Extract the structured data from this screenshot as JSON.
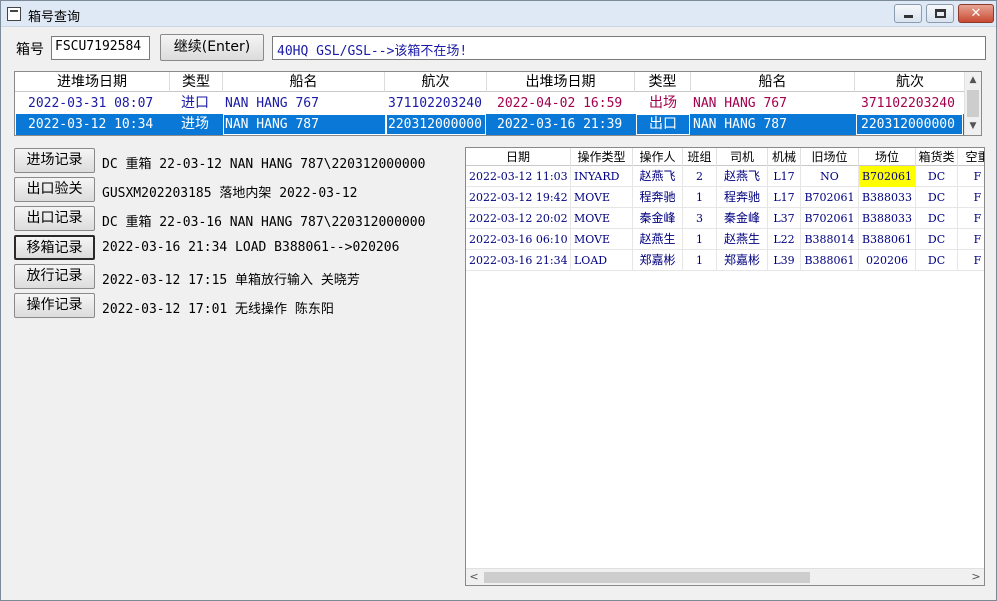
{
  "window": {
    "title": "箱号查询",
    "controls": {
      "minimize": "minimize-icon",
      "maximize": "maximize-icon",
      "close": "close-icon",
      "close_glyph": "✕"
    }
  },
  "search": {
    "label": "箱号",
    "value": "FSCU7192584",
    "continue_label": "继续(Enter)",
    "message": "40HQ GSL/GSL-->该箱不在场!"
  },
  "top_list": {
    "columns": [
      "进堆场日期",
      "类型",
      "船名",
      "航次",
      "出堆场日期",
      "类型",
      "船名",
      "航次"
    ],
    "rows": [
      {
        "in_date": "2022-03-31 08:07",
        "in_type": "进口",
        "in_vessel": "NAN HANG 767",
        "in_voyage": "371102203240",
        "out_date": "2022-04-02 16:59",
        "out_type": "出场",
        "out_vessel": "NAN HANG 767",
        "out_voyage": "371102203240"
      },
      {
        "in_date": "2022-03-12 10:34",
        "in_type": "进场",
        "in_vessel": "NAN HANG 787",
        "in_voyage": "220312000000",
        "out_date": "2022-03-16 21:39",
        "out_type": "出口",
        "out_vessel": "NAN HANG 787",
        "out_voyage": "220312000000"
      }
    ],
    "scroll_up": "▲",
    "scroll_down": "▼"
  },
  "records": [
    {
      "button": "进场记录",
      "text": "DC 重箱 22-03-12 NAN HANG 787\\220312000000"
    },
    {
      "button": "出口验关",
      "text": "GUSXM202203185 落地内架 2022-03-12"
    },
    {
      "button": "出口记录",
      "text": "DC 重箱 22-03-16 NAN HANG 787\\220312000000"
    },
    {
      "button": "移箱记录",
      "text": "2022-03-16 21:34 LOAD B388061-->020206"
    },
    {
      "button": "放行记录",
      "text": "2022-03-12 17:15 单箱放行输入 关晓芳"
    },
    {
      "button": "操作记录",
      "text": "2022-03-12 17:01 无线操作 陈东阳"
    }
  ],
  "grid": {
    "columns": [
      "日期",
      "操作类型",
      "操作人",
      "班组",
      "司机",
      "机械",
      "旧场位",
      "场位",
      "箱货类",
      "空重"
    ],
    "rows": [
      [
        "2022-03-12 11:03",
        "INYARD",
        "赵燕飞",
        "2",
        "赵燕飞",
        "L17",
        "NO",
        "B702061",
        "DC",
        "F"
      ],
      [
        "2022-03-12 19:42",
        "MOVE",
        "程奔驰",
        "1",
        "程奔驰",
        "L17",
        "B702061",
        "B388033",
        "DC",
        "F"
      ],
      [
        "2022-03-12 20:02",
        "MOVE",
        "秦金峰",
        "3",
        "秦金峰",
        "L37",
        "B702061",
        "B388033",
        "DC",
        "F"
      ],
      [
        "2022-03-16 06:10",
        "MOVE",
        "赵燕生",
        "1",
        "赵燕生",
        "L22",
        "B388014",
        "B388061",
        "DC",
        "F"
      ],
      [
        "2022-03-16 21:34",
        "LOAD",
        "郑嘉彬",
        "1",
        "郑嘉彬",
        "L39",
        "B388061",
        "020206",
        "DC",
        "F"
      ]
    ],
    "scroll_left": "<",
    "scroll_right": ">"
  },
  "colors": {
    "selection": "#0a78d7",
    "in_row_text": "#1a1aa6",
    "out_row_text": "#a3004d",
    "grid_text": "#000080",
    "highlight": "#ffff00"
  }
}
